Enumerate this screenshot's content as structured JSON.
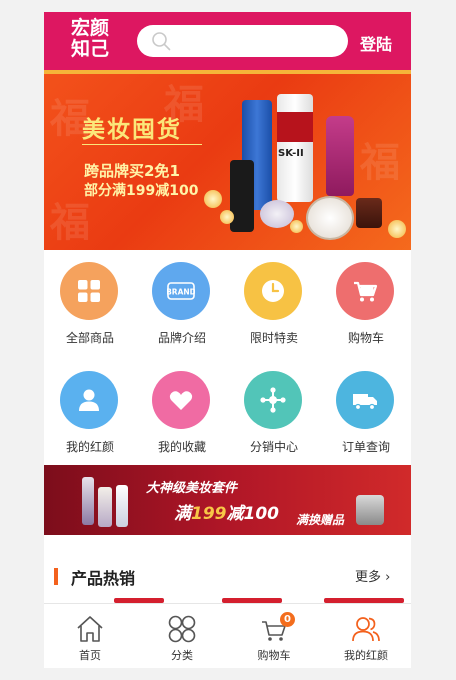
{
  "header": {
    "logo_line1": "宏颜",
    "logo_line2": "知己",
    "search_placeholder": "",
    "login_label": "登陆"
  },
  "banner": {
    "title": "美妆囤货",
    "line1": "跨品牌买2免1",
    "line2": "部分满199减100",
    "brand_sk2": "SK-II"
  },
  "categories": [
    {
      "label": "全部商品",
      "icon": "grid-icon",
      "color": "#f5a25d"
    },
    {
      "label": "品牌介绍",
      "icon": "brand-icon",
      "color": "#5fa8ee",
      "icon_text": "BRAND"
    },
    {
      "label": "限时特卖",
      "icon": "clock-icon",
      "color": "#f7c244"
    },
    {
      "label": "购物车",
      "icon": "cart-icon",
      "color": "#ee6e6e"
    },
    {
      "label": "我的红颜",
      "icon": "user-icon",
      "color": "#5ab1ef"
    },
    {
      "label": "我的收藏",
      "icon": "heart-icon",
      "color": "#f06ba3"
    },
    {
      "label": "分销中心",
      "icon": "share-icon",
      "color": "#52c5b8"
    },
    {
      "label": "订单查询",
      "icon": "truck-icon",
      "color": "#4db5df"
    }
  ],
  "promo": {
    "title": "大神级美妆套件",
    "offer_prefix": "满",
    "offer_num": "199",
    "offer_suffix": "减100",
    "gift": "满换赠品"
  },
  "section": {
    "title": "产品热销",
    "more": "更多 ›"
  },
  "tabbar": [
    {
      "label": "首页",
      "icon": "home-icon"
    },
    {
      "label": "分类",
      "icon": "category-icon"
    },
    {
      "label": "购物车",
      "icon": "cart-icon",
      "badge": "0"
    },
    {
      "label": "我的红颜",
      "icon": "user-icon",
      "active": true
    }
  ],
  "colors": {
    "brand": "#dd1761",
    "accent": "#f3611d"
  }
}
